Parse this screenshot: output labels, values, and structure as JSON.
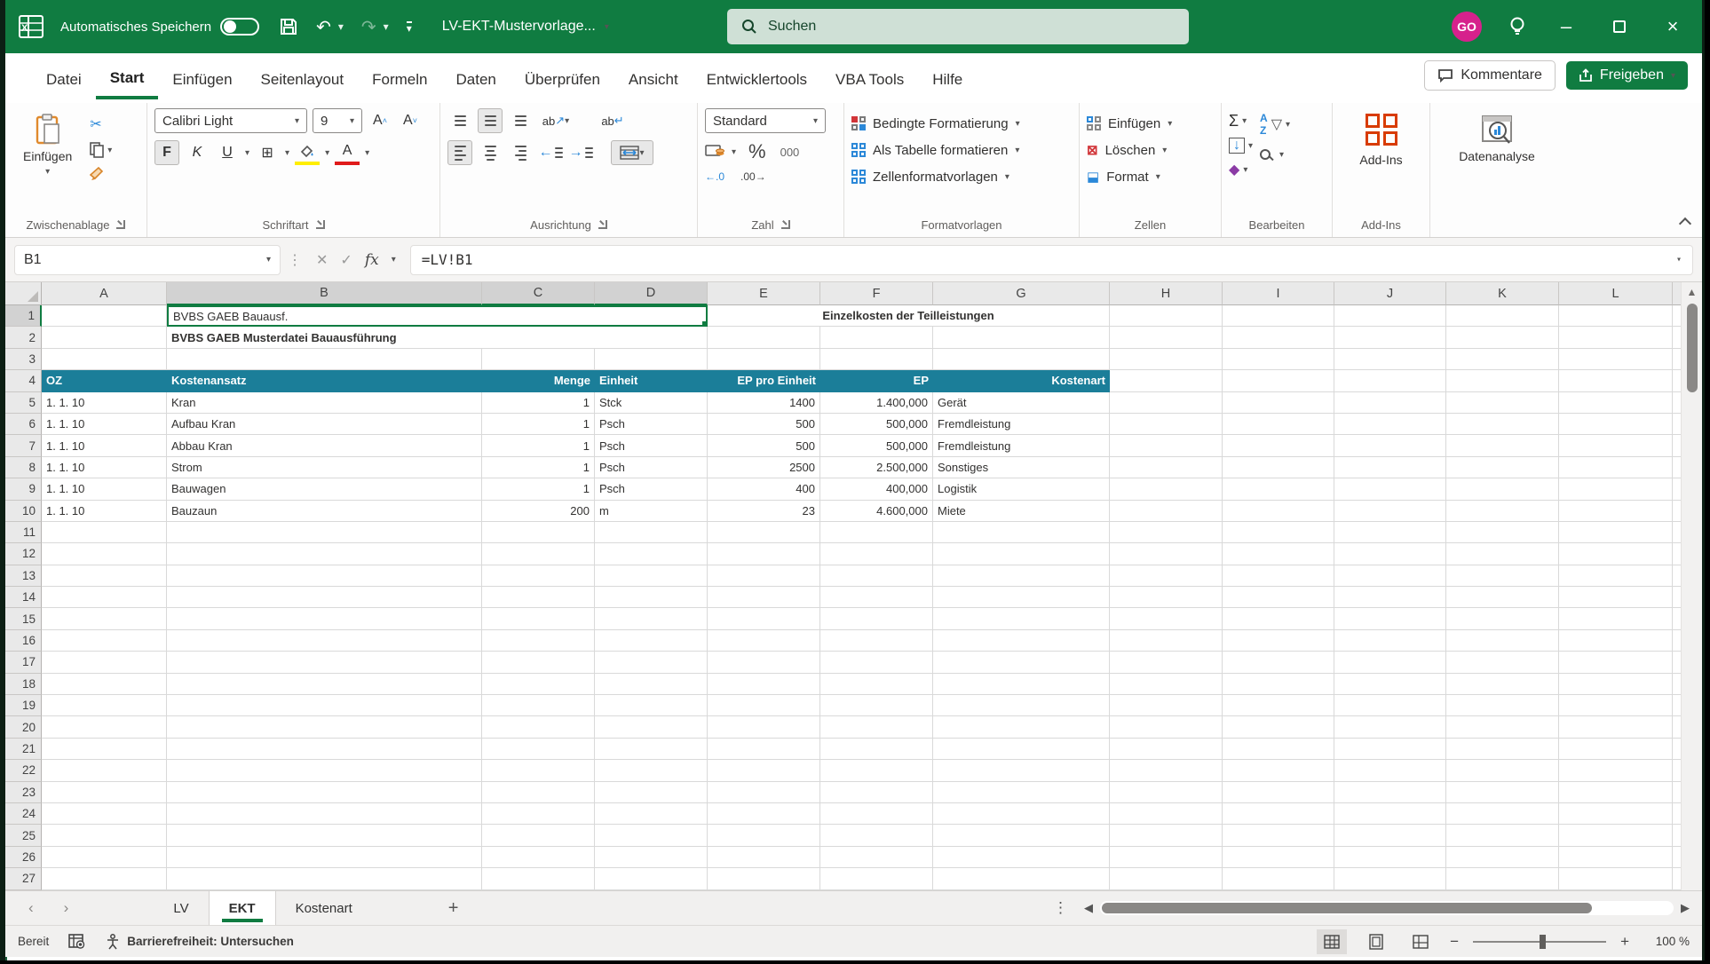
{
  "colors": {
    "excel_green": "#107C41",
    "table_header_teal": "#1B7E99",
    "avatar_pink": "#D6218C",
    "highlight_yellow": "#FFEE00",
    "font_color_red": "#E01B1B"
  },
  "titlebar": {
    "autosave_label": "Automatisches Speichern",
    "doc_title": "LV-EKT-Mustervorlage...",
    "search_placeholder": "Suchen",
    "avatar_initials": "GO"
  },
  "menubar": {
    "tabs": [
      {
        "label": "Datei",
        "active": false
      },
      {
        "label": "Start",
        "active": true
      },
      {
        "label": "Einfügen",
        "active": false
      },
      {
        "label": "Seitenlayout",
        "active": false
      },
      {
        "label": "Formeln",
        "active": false
      },
      {
        "label": "Daten",
        "active": false
      },
      {
        "label": "Überprüfen",
        "active": false
      },
      {
        "label": "Ansicht",
        "active": false
      },
      {
        "label": "Entwicklertools",
        "active": false
      },
      {
        "label": "VBA Tools",
        "active": false
      },
      {
        "label": "Hilfe",
        "active": false
      }
    ],
    "comments_label": "Kommentare",
    "share_label": "Freigeben"
  },
  "ribbon": {
    "clipboard": {
      "group_label": "Zwischenablage",
      "paste_label": "Einfügen"
    },
    "font": {
      "group_label": "Schriftart",
      "font_name": "Calibri Light",
      "font_size": "9",
      "bold_label": "F",
      "italic_label": "K",
      "underline_label": "U"
    },
    "alignment": {
      "group_label": "Ausrichtung",
      "wrap_label": "ab",
      "orient_label": "ab"
    },
    "number": {
      "group_label": "Zahl",
      "format_value": "Standard",
      "percent_label": "%",
      "thousands_label": "000",
      "dec_left": "←.0",
      "dec_right": ".00→"
    },
    "styles": {
      "group_label": "Formatvorlagen",
      "items": [
        "Bedingte Formatierung",
        "Als Tabelle formatieren",
        "Zellenformatvorlagen"
      ]
    },
    "cells": {
      "group_label": "Zellen",
      "items": [
        "Einfügen",
        "Löschen",
        "Format"
      ]
    },
    "editing": {
      "group_label": "Bearbeiten",
      "sum_label": "Σ",
      "sort_label": "AZ"
    },
    "addins": {
      "group_label": "Add-Ins",
      "button_label": "Add-Ins"
    },
    "analysis": {
      "button_label": "Datenanalyse"
    }
  },
  "formula_bar": {
    "name_box": "B1",
    "formula": "=LV!B1"
  },
  "sheet": {
    "columns": [
      "A",
      "B",
      "C",
      "D",
      "E",
      "F",
      "G",
      "H",
      "I",
      "J",
      "K",
      "L"
    ],
    "selected_columns": [
      "B",
      "C",
      "D"
    ],
    "selected_row": 1,
    "row_count": 27,
    "cells": {
      "B1": "BVBS GAEB Bauausf.",
      "E1_merged_title": "Einzelkosten der Teilleistungen",
      "B2": "BVBS GAEB Musterdatei Bauausführung"
    },
    "table": {
      "header_row": 4,
      "headers": [
        "OZ",
        "Kostenansatz",
        "Menge",
        "Einheit",
        "EP pro Einheit",
        "EP",
        "Kostenart"
      ],
      "header_aligns": [
        "left",
        "left",
        "right",
        "left",
        "right",
        "right",
        "right"
      ],
      "aligns": [
        "left",
        "left",
        "right",
        "left",
        "right",
        "right",
        "left"
      ],
      "first_data_row": 5,
      "rows": [
        [
          "1. 1. 10",
          "Kran",
          "1",
          "Stck",
          "1400",
          "1.400,000",
          "Gerät"
        ],
        [
          "1. 1. 10",
          "Aufbau Kran",
          "1",
          "Psch",
          "500",
          "500,000",
          "Fremdleistung"
        ],
        [
          "1. 1. 10",
          "Abbau Kran",
          "1",
          "Psch",
          "500",
          "500,000",
          "Fremdleistung"
        ],
        [
          "1. 1. 10",
          "Strom",
          "1",
          "Psch",
          "2500",
          "2.500,000",
          "Sonstiges"
        ],
        [
          "1. 1. 10",
          "Bauwagen",
          "1",
          "Psch",
          "400",
          "400,000",
          "Logistik"
        ],
        [
          "1. 1. 10",
          "Bauzaun",
          "200",
          "m",
          "23",
          "4.600,000",
          "Miete"
        ]
      ]
    }
  },
  "tabbar": {
    "sheets": [
      {
        "label": "LV",
        "active": false
      },
      {
        "label": "EKT",
        "active": true
      },
      {
        "label": "Kostenart",
        "active": false
      }
    ],
    "add_label": "+"
  },
  "statusbar": {
    "ready_label": "Bereit",
    "accessibility_label": "Barrierefreiheit: Untersuchen",
    "zoom_level": "100 %"
  }
}
